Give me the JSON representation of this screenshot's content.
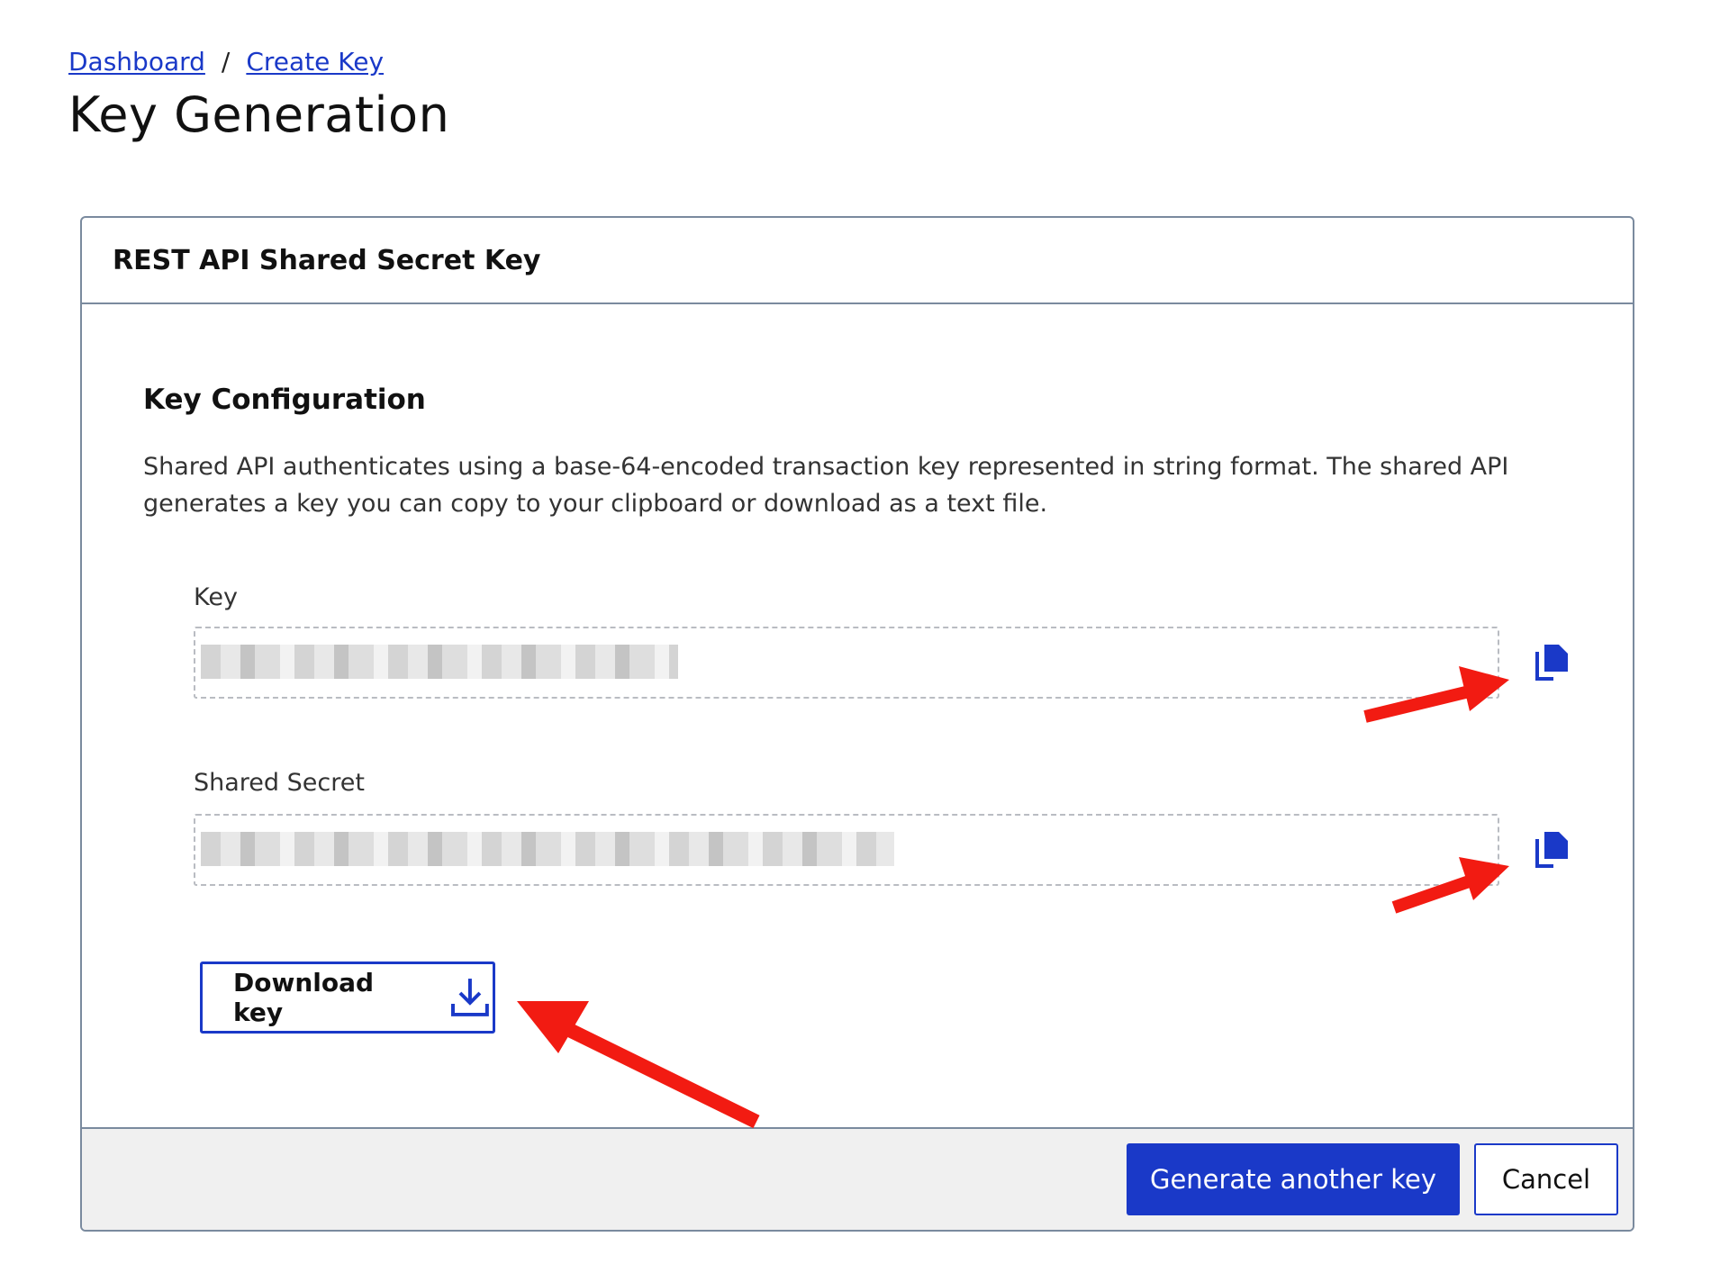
{
  "breadcrumb": {
    "items": [
      "Dashboard",
      "Create Key"
    ],
    "separator": "/"
  },
  "page": {
    "title": "Key Generation"
  },
  "card": {
    "header": "REST API Shared Secret Key",
    "section_title": "Key Configuration",
    "description": "Shared API authenticates using a base-64-encoded transaction key represented in string format. The shared API generates a key you can copy to your clipboard or download as a text file.",
    "fields": {
      "key": {
        "label": "Key"
      },
      "secret": {
        "label": "Shared Secret"
      }
    },
    "download_label": "Download key"
  },
  "footer": {
    "primary_label": "Generate another key",
    "cancel_label": "Cancel"
  },
  "colors": {
    "accent": "#1a39c8",
    "annotation_arrow": "#f21b12"
  },
  "icons": {
    "copy": "copy-icon",
    "download": "download-icon"
  }
}
